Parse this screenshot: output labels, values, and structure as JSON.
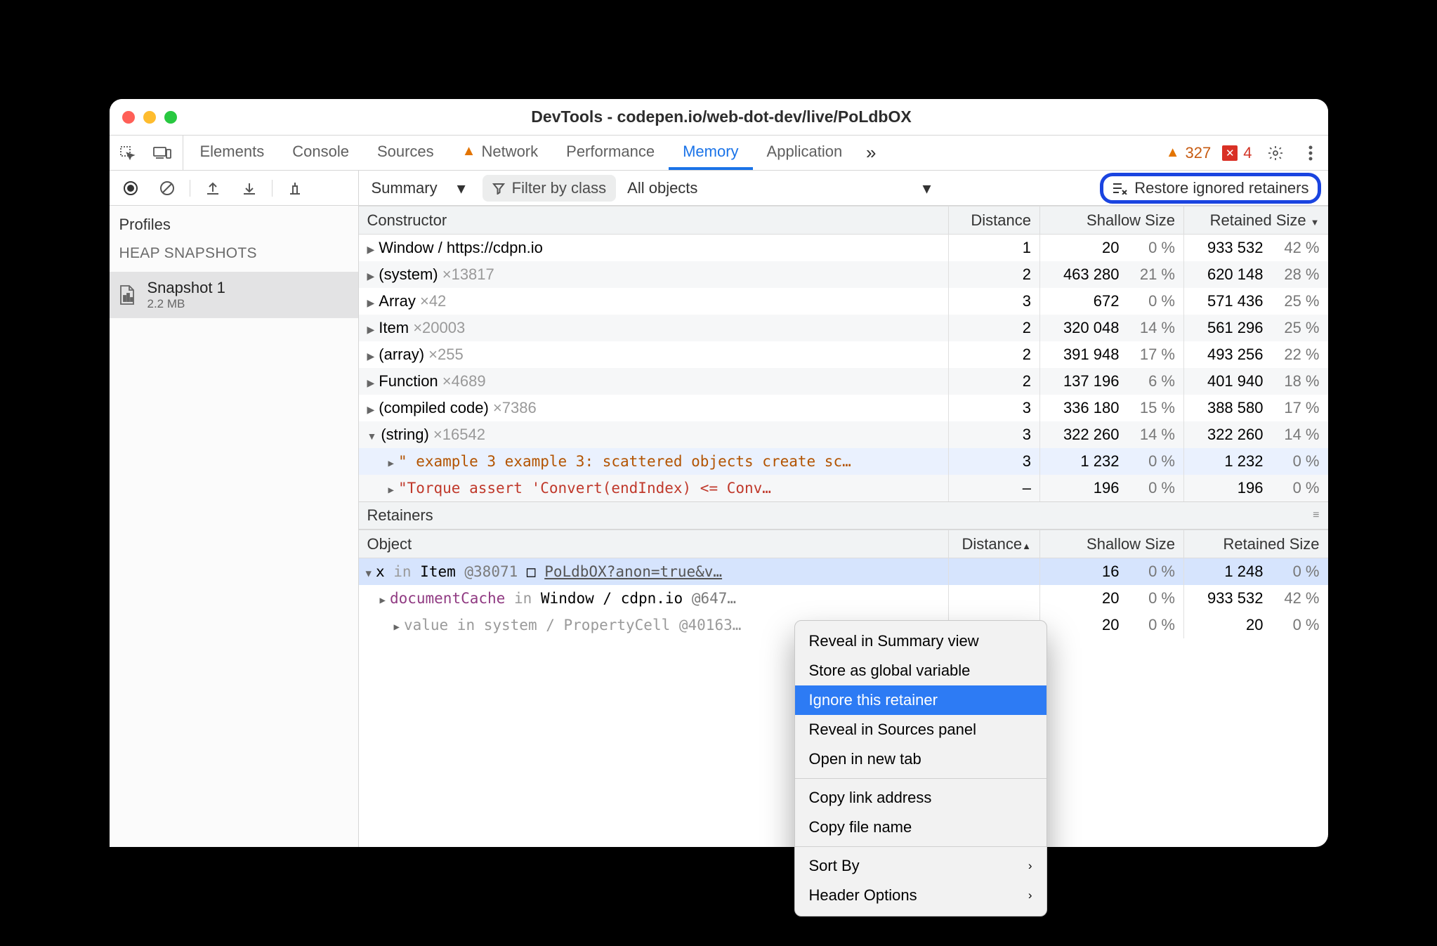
{
  "window": {
    "title": "DevTools - codepen.io/web-dot-dev/live/PoLdbOX"
  },
  "tabs": {
    "items": [
      "Elements",
      "Console",
      "Sources",
      "Network",
      "Performance",
      "Memory",
      "Application"
    ],
    "active_index": 5,
    "warn_count": "327",
    "err_count": "4"
  },
  "sidebar": {
    "profiles_label": "Profiles",
    "group_label": "HEAP SNAPSHOTS",
    "snapshot": {
      "name": "Snapshot 1",
      "size": "2.2 MB"
    }
  },
  "toolbar": {
    "view_dropdown": "Summary",
    "filter_placeholder": "Filter by class",
    "perspective": "All objects",
    "restore_label": "Restore ignored retainers"
  },
  "columns": {
    "constructor": "Constructor",
    "distance": "Distance",
    "shallow": "Shallow Size",
    "retained": "Retained Size",
    "object": "Object"
  },
  "rows": [
    {
      "name": "Window / https://cdpn.io",
      "count": "",
      "dist": "1",
      "sv": "20",
      "sp": "0 %",
      "rv": "933 532",
      "rp": "42 %"
    },
    {
      "name": "(system)",
      "count": "×13817",
      "dist": "2",
      "sv": "463 280",
      "sp": "21 %",
      "rv": "620 148",
      "rp": "28 %"
    },
    {
      "name": "Array",
      "count": "×42",
      "dist": "3",
      "sv": "672",
      "sp": "0 %",
      "rv": "571 436",
      "rp": "25 %"
    },
    {
      "name": "Item",
      "count": "×20003",
      "dist": "2",
      "sv": "320 048",
      "sp": "14 %",
      "rv": "561 296",
      "rp": "25 %"
    },
    {
      "name": "(array)",
      "count": "×255",
      "dist": "2",
      "sv": "391 948",
      "sp": "17 %",
      "rv": "493 256",
      "rp": "22 %"
    },
    {
      "name": "Function",
      "count": "×4689",
      "dist": "2",
      "sv": "137 196",
      "sp": "6 %",
      "rv": "401 940",
      "rp": "18 %"
    },
    {
      "name": "(compiled code)",
      "count": "×7386",
      "dist": "3",
      "sv": "336 180",
      "sp": "15 %",
      "rv": "388 580",
      "rp": "17 %"
    },
    {
      "name": "(string)",
      "count": "×16542",
      "dist": "3",
      "sv": "322 260",
      "sp": "14 %",
      "rv": "322 260",
      "rp": "14 %",
      "open": true
    }
  ],
  "string_children": [
    {
      "text": "\" example 3 example 3: scattered objects create sc…",
      "dist": "3",
      "sv": "1 232",
      "sp": "0 %",
      "rv": "1 232",
      "rp": "0 %",
      "cls": "str-green"
    },
    {
      "text": "\"Torque assert 'Convert<uintptr>(endIndex) <= Conv…",
      "dist": "–",
      "sv": "196",
      "sp": "0 %",
      "rv": "196",
      "rp": "0 %",
      "cls": "str-red"
    }
  ],
  "retainers": {
    "label": "Retainers"
  },
  "retainer_rows": [
    {
      "html": "x <span class='dim'>in</span> Item <span class='atnum'>@38071</span>  □ <span class='link'>PoLdbOX?anon=true&v…</span>",
      "dist": "",
      "sv": "16",
      "sp": "0 %",
      "rv": "1 248",
      "rp": "0 %",
      "sel": true,
      "open": true
    },
    {
      "html": "<span class='keyprop'>documentCache</span> <span class='dim'>in</span> Window / cdpn.io <span class='atnum'>@647…</span>",
      "dist": "",
      "sv": "20",
      "sp": "0 %",
      "rv": "933 532",
      "rp": "42 %",
      "open": false
    },
    {
      "html": "<span class='dim'>value in system / PropertyCell @40163…</span>",
      "dist": "",
      "sv": "20",
      "sp": "0 %",
      "rv": "20",
      "rp": "0 %",
      "open": false,
      "dim": true
    }
  ],
  "context_menu": {
    "items": [
      {
        "label": "Reveal in Summary view"
      },
      {
        "label": "Store as global variable"
      },
      {
        "label": "Ignore this retainer",
        "highlight": true
      },
      {
        "label": "Reveal in Sources panel"
      },
      {
        "label": "Open in new tab"
      },
      {
        "sep": true
      },
      {
        "label": "Copy link address"
      },
      {
        "label": "Copy file name"
      },
      {
        "sep": true
      },
      {
        "label": "Sort By",
        "submenu": true
      },
      {
        "label": "Header Options",
        "submenu": true
      }
    ]
  }
}
